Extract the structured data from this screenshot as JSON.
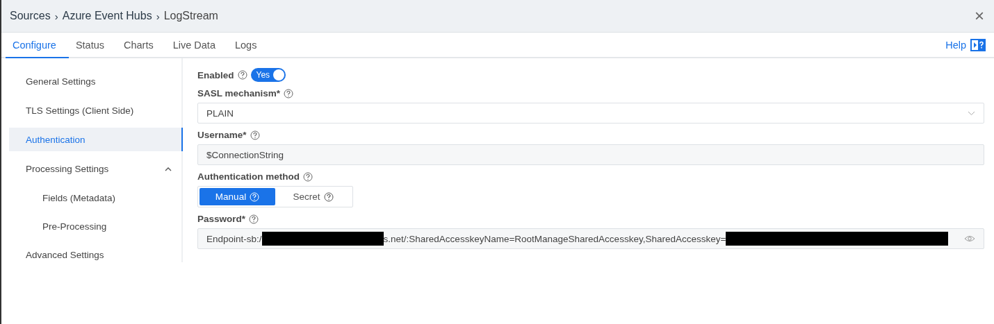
{
  "breadcrumb": [
    "Sources",
    "Azure Event Hubs",
    "LogStream"
  ],
  "breadcrumb_separator": "›",
  "close": "×",
  "tabs": [
    {
      "label": "Configure",
      "selected": true
    },
    {
      "label": "Status",
      "selected": false
    },
    {
      "label": "Charts",
      "selected": false
    },
    {
      "label": "Live Data",
      "selected": false
    },
    {
      "label": "Logs",
      "selected": false
    }
  ],
  "help": "Help",
  "sidebar": {
    "items": [
      {
        "label": "General Settings",
        "selected": false
      },
      {
        "label": "TLS Settings (Client Side)",
        "selected": false
      },
      {
        "label": "Authentication",
        "selected": true
      },
      {
        "label": "Processing Settings",
        "selected": false,
        "expanded": true,
        "children": [
          {
            "label": "Fields (Metadata)",
            "selected": false
          },
          {
            "label": "Pre-Processing",
            "selected": false
          }
        ]
      },
      {
        "label": "Advanced Settings",
        "selected": false
      }
    ]
  },
  "enabled": {
    "label": "Enabled",
    "on": true,
    "text": "Yes"
  },
  "sasl": {
    "label": "SASL mechanism*",
    "value": "PLAIN"
  },
  "username": {
    "label": "Username*",
    "value": "$ConnectionString"
  },
  "auth_method": {
    "label": "Authentication method",
    "options": [
      {
        "label": "Manual",
        "selected": true
      },
      {
        "label": "Secret",
        "selected": false
      }
    ]
  },
  "password": {
    "label": "Password*",
    "parts": [
      {
        "kind": "text",
        "text": "Endpoint-sb:/"
      },
      {
        "kind": "redacted"
      },
      {
        "kind": "text",
        "text": "s.net/:SharedAccesskeyName=RootManageSharedAccesskey,SharedAccesskey="
      },
      {
        "kind": "redacted"
      }
    ]
  }
}
